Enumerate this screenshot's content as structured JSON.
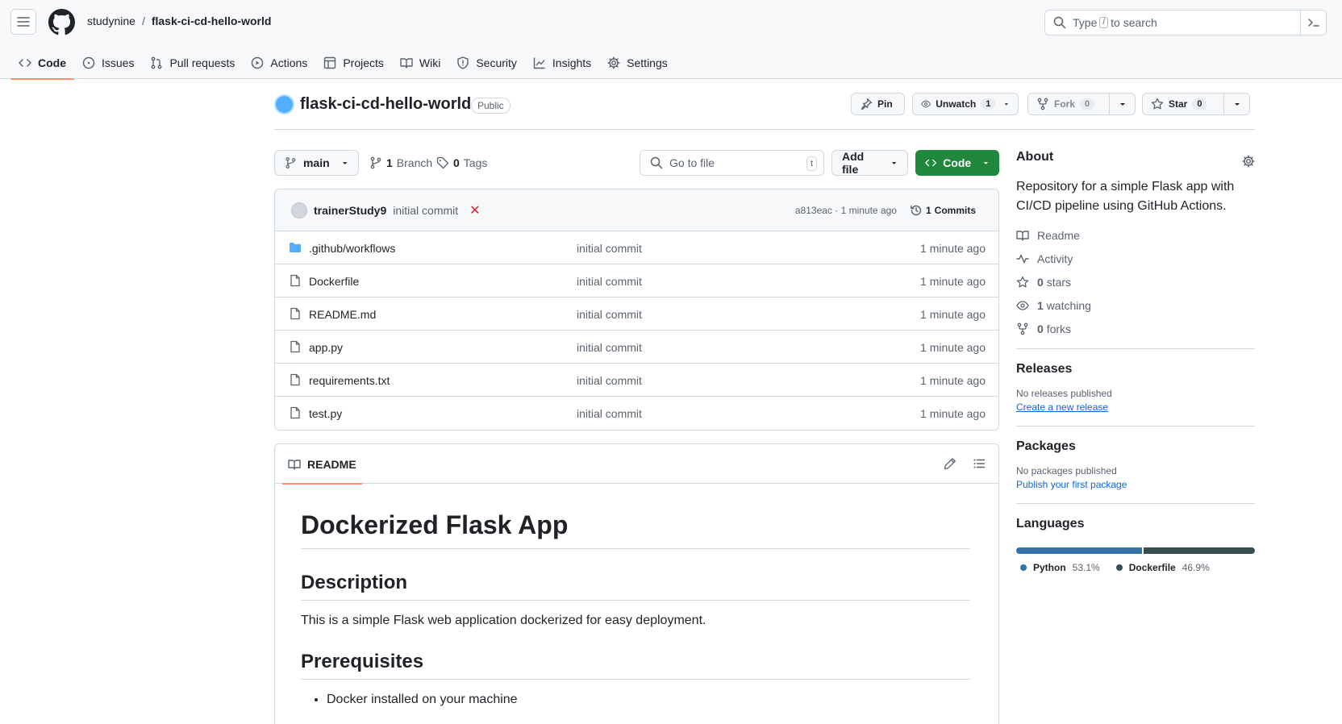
{
  "header": {
    "owner": "studynine",
    "separator": "/",
    "repo": "flask-ci-cd-hello-world",
    "search_prefix": "Type",
    "search_key": "/",
    "search_suffix": "to search"
  },
  "tabs": [
    {
      "label": "Code",
      "icon": "code-icon"
    },
    {
      "label": "Issues",
      "icon": "issue-icon"
    },
    {
      "label": "Pull requests",
      "icon": "pull-request-icon"
    },
    {
      "label": "Actions",
      "icon": "play-icon"
    },
    {
      "label": "Projects",
      "icon": "table-icon"
    },
    {
      "label": "Wiki",
      "icon": "book-icon"
    },
    {
      "label": "Security",
      "icon": "shield-icon"
    },
    {
      "label": "Insights",
      "icon": "graph-icon"
    },
    {
      "label": "Settings",
      "icon": "gear-icon"
    }
  ],
  "repo_head": {
    "title": "flask-ci-cd-hello-world",
    "visibility": "Public",
    "pin": "Pin",
    "unwatch": "Unwatch",
    "watch_count": "1",
    "fork": "Fork",
    "fork_count": "0",
    "star": "Star",
    "star_count": "0"
  },
  "branch_row": {
    "branch": "main",
    "branches_count": "1",
    "branches_label": "Branch",
    "tags_count": "0",
    "tags_label": "Tags",
    "goto_placeholder": "Go to file",
    "goto_key": "t",
    "add_file": "Add file",
    "code": "Code"
  },
  "commit": {
    "author": "trainerStudy9",
    "message": "initial commit",
    "status": "✕",
    "sha_time": "a813eac · 1 minute ago",
    "commits_count": "1",
    "commits_label": "Commits"
  },
  "files": [
    {
      "name": ".github/workflows",
      "type": "folder",
      "message": "initial commit",
      "time": "1 minute ago"
    },
    {
      "name": "Dockerfile",
      "type": "file",
      "message": "initial commit",
      "time": "1 minute ago"
    },
    {
      "name": "README.md",
      "type": "file",
      "message": "initial commit",
      "time": "1 minute ago"
    },
    {
      "name": "app.py",
      "type": "file",
      "message": "initial commit",
      "time": "1 minute ago"
    },
    {
      "name": "requirements.txt",
      "type": "file",
      "message": "initial commit",
      "time": "1 minute ago"
    },
    {
      "name": "test.py",
      "type": "file",
      "message": "initial commit",
      "time": "1 minute ago"
    }
  ],
  "readme": {
    "tab": "README",
    "h1": "Dockerized Flask App",
    "h2_description": "Description",
    "description": "This is a simple Flask web application dockerized for easy deployment.",
    "h2_prereq": "Prerequisites",
    "prereq_items": [
      "Docker installed on your machine"
    ]
  },
  "sidebar": {
    "about_title": "About",
    "about_desc": "Repository for a simple Flask app with CI/CD pipeline using GitHub Actions.",
    "readme": "Readme",
    "activity": "Activity",
    "stars_count": "0",
    "stars_label": "stars",
    "watching_count": "1",
    "watching_label": "watching",
    "forks_count": "0",
    "forks_label": "forks",
    "releases_title": "Releases",
    "releases_none": "No releases published",
    "releases_link": "Create a new release",
    "packages_title": "Packages",
    "packages_none": "No packages published",
    "packages_link": "Publish your first package",
    "languages_title": "Languages",
    "languages": [
      {
        "name": "Python",
        "percent": "53.1%",
        "value": 53.1,
        "color": "#3572A5"
      },
      {
        "name": "Dockerfile",
        "percent": "46.9%",
        "value": 46.9,
        "color": "#384d54"
      }
    ]
  }
}
